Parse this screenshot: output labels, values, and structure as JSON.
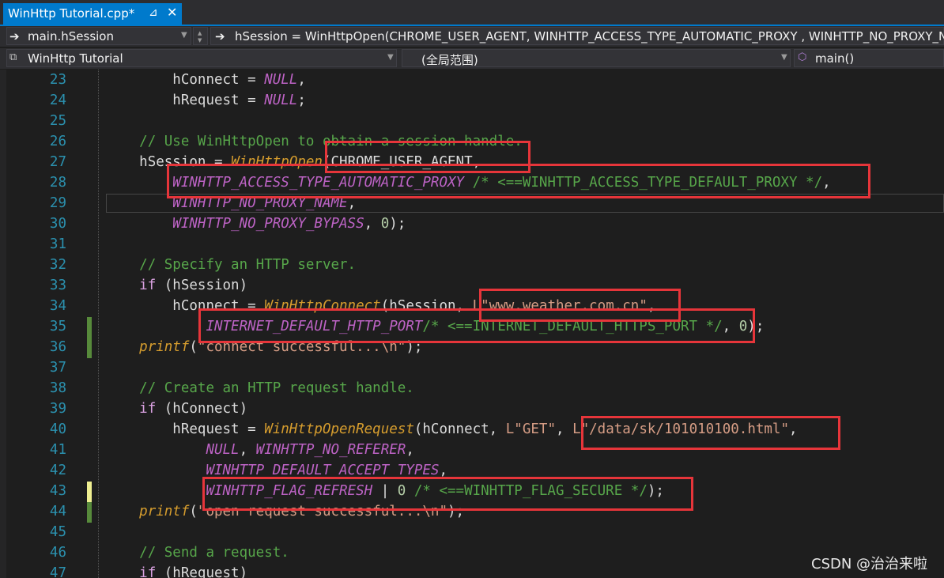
{
  "tab": {
    "title": "WinHttp Tutorial.cpp*",
    "pin_icon": "pin-icon",
    "close_icon": "close-icon"
  },
  "navbar": {
    "member_dropdown": "main.hSession",
    "statement": "hSession = WinHttpOpen(CHROME_USER_AGENT, WINHTTP_ACCESS_TYPE_AUTOMATIC_PROXY , WINHTTP_NO_PROXY_NA",
    "project_dropdown": "WinHttp Tutorial",
    "scope_dropdown": "(全局范围)",
    "function_dropdown": "main()"
  },
  "editor": {
    "lines": [
      {
        "num": "23",
        "indent": "        ",
        "tokens": [
          {
            "t": "hConnect = ",
            "c": ""
          },
          {
            "t": "NULL",
            "c": "c-macro"
          },
          {
            "t": ",",
            "c": ""
          }
        ]
      },
      {
        "num": "24",
        "indent": "        ",
        "tokens": [
          {
            "t": "hRequest = ",
            "c": ""
          },
          {
            "t": "NULL",
            "c": "c-macro"
          },
          {
            "t": ";",
            "c": ""
          }
        ]
      },
      {
        "num": "25",
        "indent": "",
        "tokens": []
      },
      {
        "num": "26",
        "indent": "    ",
        "tokens": [
          {
            "t": "// Use WinHttpOpen to obtain a session handle.",
            "c": "c-comment"
          }
        ]
      },
      {
        "num": "27",
        "indent": "    ",
        "tokens": [
          {
            "t": "hSession = ",
            "c": ""
          },
          {
            "t": "WinHttpOpen",
            "c": "c-func"
          },
          {
            "t": "(CHROME_USER_AGENT,",
            "c": ""
          }
        ]
      },
      {
        "num": "28",
        "indent": "        ",
        "tokens": [
          {
            "t": "WINHTTP_ACCESS_TYPE_AUTOMATIC_PROXY",
            "c": "c-macro"
          },
          {
            "t": " /* <==WINHTTP_ACCESS_TYPE_DEFAULT_PROXY */",
            "c": "c-comment"
          },
          {
            "t": ",",
            "c": ""
          }
        ]
      },
      {
        "num": "29",
        "indent": "        ",
        "tokens": [
          {
            "t": "WINHTTP_NO_PROXY_NAME",
            "c": "c-macro"
          },
          {
            "t": ",",
            "c": ""
          }
        ]
      },
      {
        "num": "30",
        "indent": "        ",
        "tokens": [
          {
            "t": "WINHTTP_NO_PROXY_BYPASS",
            "c": "c-macro"
          },
          {
            "t": ", ",
            "c": ""
          },
          {
            "t": "0",
            "c": "c-num"
          },
          {
            "t": ");",
            "c": ""
          }
        ]
      },
      {
        "num": "31",
        "indent": "",
        "tokens": []
      },
      {
        "num": "32",
        "indent": "    ",
        "tokens": [
          {
            "t": "// Specify an HTTP server.",
            "c": "c-comment"
          }
        ]
      },
      {
        "num": "33",
        "indent": "    ",
        "tokens": [
          {
            "t": "if",
            "c": "c-kw"
          },
          {
            "t": " (hSession)",
            "c": ""
          }
        ]
      },
      {
        "num": "34",
        "indent": "        ",
        "tokens": [
          {
            "t": "hConnect = ",
            "c": ""
          },
          {
            "t": "WinHttpConnect",
            "c": "c-func"
          },
          {
            "t": "(hSession, ",
            "c": ""
          },
          {
            "t": "L\"www.weather.com.cn\"",
            "c": "c-str"
          },
          {
            "t": ",",
            "c": ""
          }
        ]
      },
      {
        "num": "35",
        "indent": "            ",
        "tokens": [
          {
            "t": "INTERNET_DEFAULT_HTTP_PORT",
            "c": "c-macro"
          },
          {
            "t": "/* <==INTERNET_DEFAULT_HTTPS_PORT */",
            "c": "c-comment"
          },
          {
            "t": ", ",
            "c": ""
          },
          {
            "t": "0",
            "c": "c-num"
          },
          {
            "t": ");",
            "c": ""
          }
        ]
      },
      {
        "num": "36",
        "indent": "    ",
        "tokens": [
          {
            "t": "printf",
            "c": "c-func"
          },
          {
            "t": "(",
            "c": ""
          },
          {
            "t": "\"connect successful...\\n\"",
            "c": "c-str"
          },
          {
            "t": ");",
            "c": ""
          }
        ]
      },
      {
        "num": "37",
        "indent": "",
        "tokens": []
      },
      {
        "num": "38",
        "indent": "    ",
        "tokens": [
          {
            "t": "// Create an HTTP request handle.",
            "c": "c-comment"
          }
        ]
      },
      {
        "num": "39",
        "indent": "    ",
        "tokens": [
          {
            "t": "if",
            "c": "c-kw"
          },
          {
            "t": " (hConnect)",
            "c": ""
          }
        ]
      },
      {
        "num": "40",
        "indent": "        ",
        "tokens": [
          {
            "t": "hRequest = ",
            "c": ""
          },
          {
            "t": "WinHttpOpenRequest",
            "c": "c-func"
          },
          {
            "t": "(hConnect, ",
            "c": ""
          },
          {
            "t": "L\"GET\"",
            "c": "c-str"
          },
          {
            "t": ", ",
            "c": ""
          },
          {
            "t": "L\"/data/sk/101010100.html\"",
            "c": "c-str"
          },
          {
            "t": ",",
            "c": ""
          }
        ]
      },
      {
        "num": "41",
        "indent": "            ",
        "tokens": [
          {
            "t": "NULL",
            "c": "c-macro"
          },
          {
            "t": ", ",
            "c": ""
          },
          {
            "t": "WINHTTP_NO_REFERER",
            "c": "c-macro"
          },
          {
            "t": ",",
            "c": ""
          }
        ]
      },
      {
        "num": "42",
        "indent": "            ",
        "tokens": [
          {
            "t": "WINHTTP_DEFAULT_ACCEPT_TYPES",
            "c": "c-macro"
          },
          {
            "t": ",",
            "c": ""
          }
        ]
      },
      {
        "num": "43",
        "indent": "            ",
        "tokens": [
          {
            "t": "WINHTTP_FLAG_REFRESH",
            "c": "c-macro"
          },
          {
            "t": " | ",
            "c": ""
          },
          {
            "t": "0",
            "c": "c-num"
          },
          {
            "t": " /* <==WINHTTP_FLAG_SECURE */",
            "c": "c-comment"
          },
          {
            "t": ");",
            "c": ""
          }
        ]
      },
      {
        "num": "44",
        "indent": "    ",
        "tokens": [
          {
            "t": "printf",
            "c": "c-func"
          },
          {
            "t": "(",
            "c": ""
          },
          {
            "t": "\"open request successful...\\n\"",
            "c": "c-str"
          },
          {
            "t": ");",
            "c": ""
          }
        ]
      },
      {
        "num": "45",
        "indent": "",
        "tokens": []
      },
      {
        "num": "46",
        "indent": "    ",
        "tokens": [
          {
            "t": "// Send a request.",
            "c": "c-comment"
          }
        ]
      },
      {
        "num": "47",
        "indent": "    ",
        "tokens": [
          {
            "t": "if",
            "c": "c-kw"
          },
          {
            "t": " (hRequest)",
            "c": ""
          }
        ]
      }
    ]
  },
  "watermark": "CSDN @治治来啦",
  "colors": {
    "accent": "#007acc",
    "highlight_box": "#e6353a",
    "comment": "#57a64a",
    "macro": "#bd63c5",
    "function": "#d69d2e",
    "string": "#d69d85"
  }
}
